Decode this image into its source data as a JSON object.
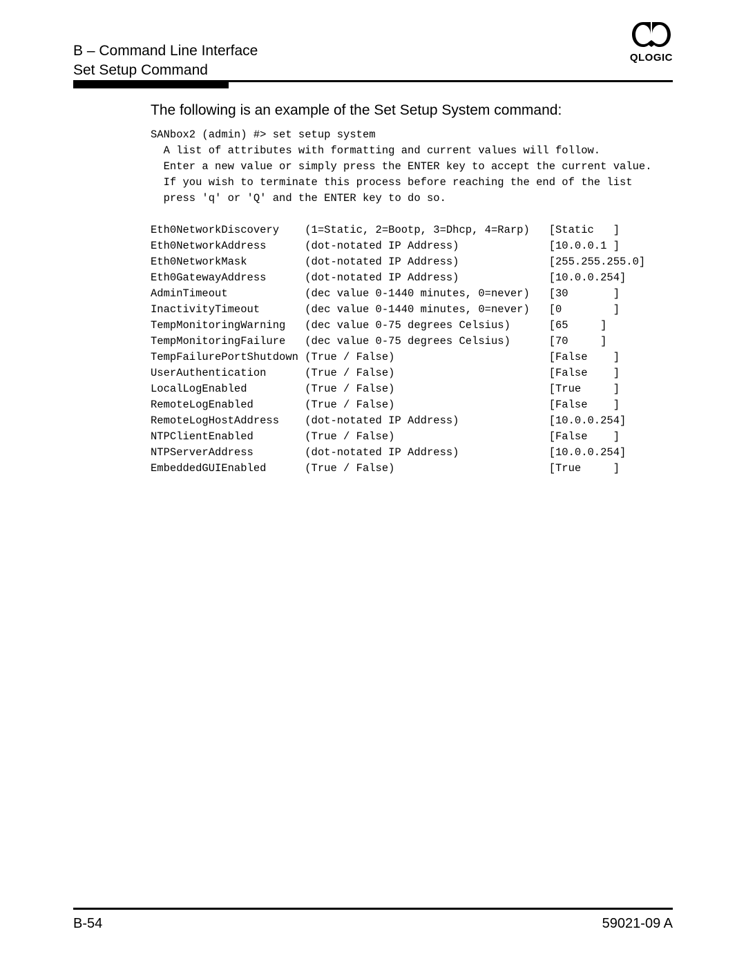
{
  "header": {
    "line1": "B – Command Line Interface",
    "line2": "Set Setup Command",
    "brand": "QLOGIC"
  },
  "intro": "The following is an example of the Set Setup System command:",
  "cli": {
    "prompt": "SANbox2 (admin) #> set setup system",
    "note1": "  A list of attributes with formatting and current values will follow.",
    "note2": "  Enter a new value or simply press the ENTER key to accept the current value.",
    "note3": "  If you wish to terminate this process before reaching the end of the list",
    "note4": "  press 'q' or 'Q' and the ENTER key to do so."
  },
  "attributes": [
    {
      "name": "Eth0NetworkDiscovery",
      "format": "(1=Static, 2=Bootp, 3=Dhcp, 4=Rarp)",
      "value": "Static",
      "vpad": 9
    },
    {
      "name": "Eth0NetworkAddress",
      "format": "(dot-notated IP Address)",
      "value": "10.0.0.1",
      "vpad": 9
    },
    {
      "name": "Eth0NetworkMask",
      "format": "(dot-notated IP Address)",
      "value": "255.255.255.0",
      "vpad": 0
    },
    {
      "name": "Eth0GatewayAddress",
      "format": "(dot-notated IP Address)",
      "value": "10.0.0.254",
      "vpad": 10
    },
    {
      "name": "AdminTimeout",
      "format": "(dec value 0-1440 minutes, 0=never)",
      "value": "30",
      "vpad": 9
    },
    {
      "name": "InactivityTimeout",
      "format": "(dec value 0-1440 minutes, 0=never)",
      "value": "0",
      "vpad": 9
    },
    {
      "name": "TempMonitoringWarning",
      "format": "(dec value 0-75 degrees Celsius)",
      "value": "65",
      "vpad": 7
    },
    {
      "name": "TempMonitoringFailure",
      "format": "(dec value 0-75 degrees Celsius)",
      "value": "70",
      "vpad": 7
    },
    {
      "name": "TempFailurePortShutdown",
      "format": "(True / False)",
      "value": "False",
      "vpad": 9
    },
    {
      "name": "UserAuthentication",
      "format": "(True / False)",
      "value": "False",
      "vpad": 9
    },
    {
      "name": "LocalLogEnabled",
      "format": "(True / False)",
      "value": "True",
      "vpad": 9
    },
    {
      "name": "RemoteLogEnabled",
      "format": "(True / False)",
      "value": "False",
      "vpad": 9
    },
    {
      "name": "RemoteLogHostAddress",
      "format": "(dot-notated IP Address)",
      "value": "10.0.0.254",
      "vpad": 10
    },
    {
      "name": "NTPClientEnabled",
      "format": "(True / False)",
      "value": "False",
      "vpad": 9
    },
    {
      "name": "NTPServerAddress",
      "format": "(dot-notated IP Address)",
      "value": "10.0.0.254",
      "vpad": 10
    },
    {
      "name": "EmbeddedGUIEnabled",
      "format": "(True / False)",
      "value": "True",
      "vpad": 9
    }
  ],
  "layout": {
    "name_width": 24,
    "format_width": 38
  },
  "footer": {
    "page": "B-54",
    "docnum": "59021-09 A"
  }
}
